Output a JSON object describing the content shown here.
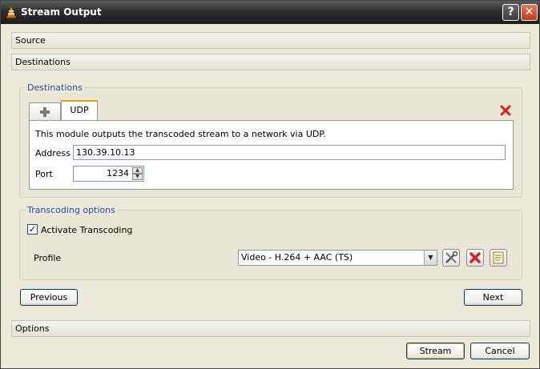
{
  "window": {
    "title": "Stream Output"
  },
  "sections": {
    "source": "Source",
    "destinations": "Destinations",
    "options": "Options"
  },
  "destinations": {
    "group_label": "Destinations",
    "tabs": [
      {
        "label": ""
      },
      {
        "label": "UDP"
      }
    ],
    "description": "This module outputs the transcoded stream to a network via UDP.",
    "address_label": "Address",
    "address_value": "130.39.10.13",
    "port_label": "Port",
    "port_value": "1234"
  },
  "transcoding": {
    "group_label": "Transcoding options",
    "activate_label": "Activate Transcoding",
    "activate_checked": true,
    "profile_label": "Profile",
    "profile_value": "Video - H.264 + AAC (TS)"
  },
  "nav": {
    "previous": "Previous",
    "next": "Next"
  },
  "footer": {
    "stream": "Stream",
    "cancel": "Cancel"
  },
  "colors": {
    "accent": "#1c4fa8",
    "delete_red": "#d92020",
    "active_tab": "#f5a000"
  },
  "icons": {
    "app": "vlc-cone-icon",
    "help": "help-icon",
    "close": "close-icon",
    "add_tab": "plus-icon",
    "remove_dest": "red-x-icon",
    "edit_profile": "tools-icon",
    "delete_profile": "red-x-icon",
    "new_profile": "new-profile-icon"
  }
}
